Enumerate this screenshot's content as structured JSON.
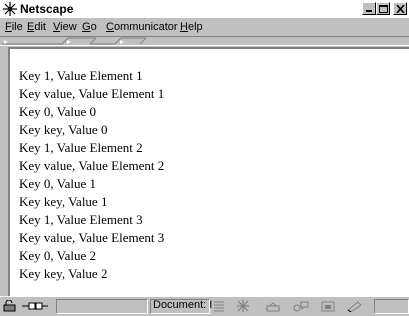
{
  "window": {
    "title": "Netscape"
  },
  "menubar": {
    "items": [
      {
        "label": "File",
        "key": "F",
        "rest": "ile"
      },
      {
        "label": "Edit",
        "key": "E",
        "rest": "dit"
      },
      {
        "label": "View",
        "key": "V",
        "rest": "iew"
      },
      {
        "label": "Go",
        "key": "G",
        "rest": "o"
      },
      {
        "label": "Communicator",
        "key": "C",
        "rest": "ommunicator"
      },
      {
        "label": "Help",
        "key": "H",
        "rest": "elp"
      }
    ]
  },
  "content": {
    "lines": [
      "Key 1, Value Element 1",
      "Key value, Value Element 1",
      "Key 0, Value 0",
      "Key key, Value 0",
      "Key 1, Value Element 2",
      "Key value, Value Element 2",
      "Key 0, Value 1",
      "Key key, Value 1",
      "Key 1, Value Element 3",
      "Key value, Value Element 3",
      "Key 0, Value 2",
      "Key key, Value 2"
    ]
  },
  "statusbar": {
    "status_text": "Document: I"
  },
  "icons": {
    "app": "netscape-logo-icon",
    "security": "security-lock-icon",
    "connection": "connection-plug-icon"
  }
}
